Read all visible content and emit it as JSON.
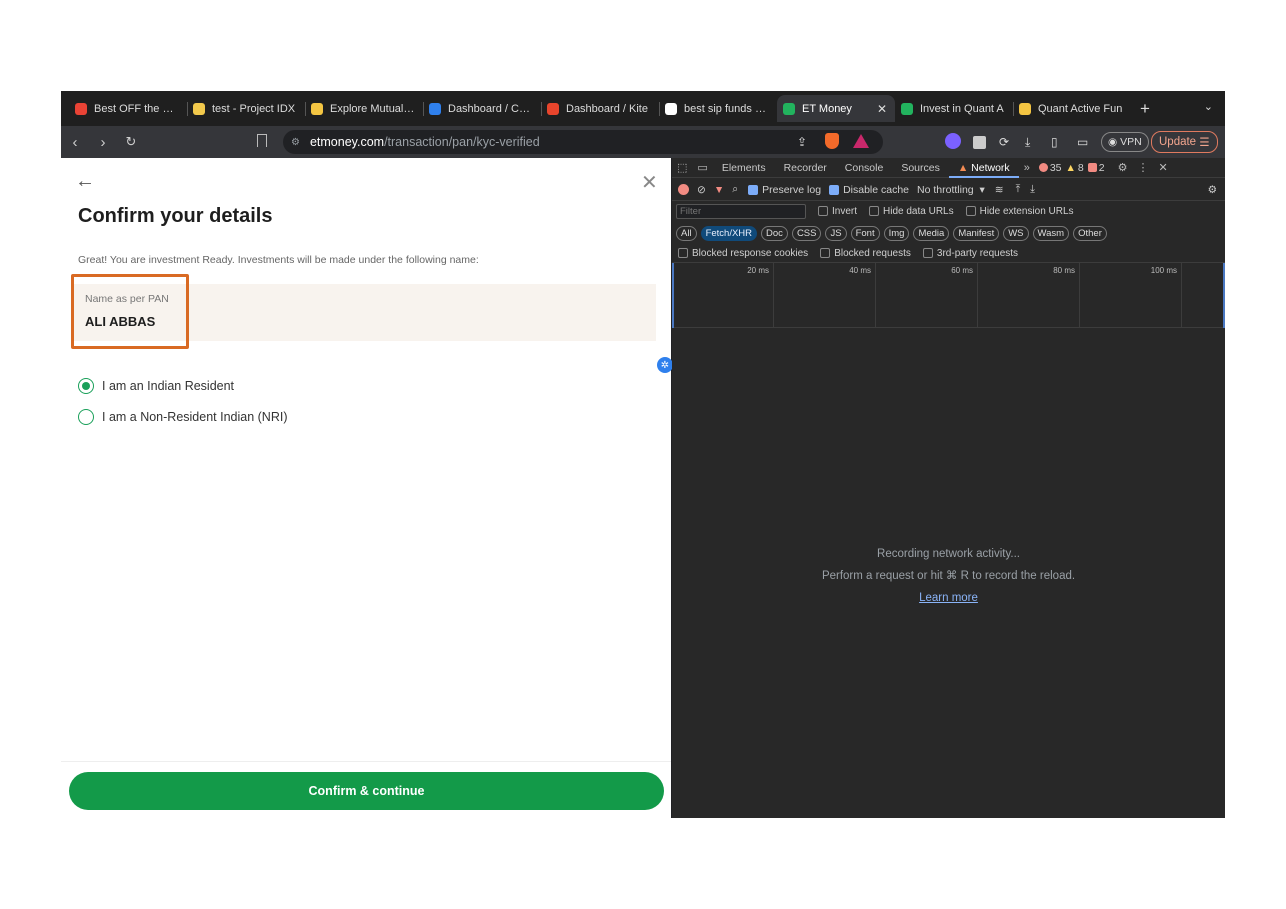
{
  "browser": {
    "tabs": [
      {
        "label": "Best OFF the best",
        "icon": "gmail-icon",
        "color": "#ea4335"
      },
      {
        "label": "test - Project IDX",
        "icon": "idx-icon",
        "color": "#f2c94c"
      },
      {
        "label": "Explore Mutual fu",
        "icon": "explore-icon",
        "color": "#f4c542"
      },
      {
        "label": "Dashboard / Cons",
        "icon": "console-icon",
        "color": "#2f80ed"
      },
      {
        "label": "Dashboard / Kite",
        "icon": "kite-icon",
        "color": "#e8452c"
      },
      {
        "label": "best sip funds - G",
        "icon": "google-icon",
        "color": "#ffffff"
      },
      {
        "label": "ET Money",
        "icon": "etmoney-icon",
        "color": "#22b35e"
      },
      {
        "label": "Invest in Quant A",
        "icon": "etmoney-icon",
        "color": "#22b35e"
      },
      {
        "label": "Quant Active Fun",
        "icon": "quant-icon",
        "color": "#f4c542"
      }
    ],
    "active_tab_index": 6,
    "new_tab": "+",
    "url_host": "etmoney.com",
    "url_path": "/transaction/pan/kyc-verified",
    "vpn_label": "VPN",
    "update_label": "Update"
  },
  "page": {
    "title": "Confirm your details",
    "intro": "Great! You are investment Ready. Investments will be made under the following name:",
    "pan_label": "Name as per PAN",
    "pan_name": "ALI ABBAS",
    "options": [
      {
        "label": "I am an Indian Resident",
        "selected": true
      },
      {
        "label": "I am a Non-Resident Indian (NRI)",
        "selected": false
      }
    ],
    "confirm_label": "Confirm & continue",
    "accent_color": "#139a49",
    "highlight_color": "#d96a23"
  },
  "devtools": {
    "tabs": [
      "Elements",
      "Recorder",
      "Console",
      "Sources",
      "Network"
    ],
    "active_tab": "Network",
    "errors": "35",
    "warnings": "8",
    "issues": "2",
    "preserve_log": "Preserve log",
    "disable_cache": "Disable cache",
    "throttling": "No throttling",
    "filter_placeholder": "Filter",
    "invert": "Invert",
    "hide_data_urls": "Hide data URLs",
    "hide_extension_urls": "Hide extension URLs",
    "types": [
      "All",
      "Fetch/XHR",
      "Doc",
      "CSS",
      "JS",
      "Font",
      "Img",
      "Media",
      "Manifest",
      "WS",
      "Wasm",
      "Other"
    ],
    "active_type": "Fetch/XHR",
    "blocked_cookies": "Blocked response cookies",
    "blocked_requests": "Blocked requests",
    "third_party": "3rd-party requests",
    "timeline_ticks": [
      "20 ms",
      "40 ms",
      "60 ms",
      "80 ms",
      "100 ms"
    ],
    "empty_title": "Recording network activity...",
    "empty_hint": "Perform a request or hit ⌘ R to record the reload.",
    "learn_more": "Learn more"
  }
}
